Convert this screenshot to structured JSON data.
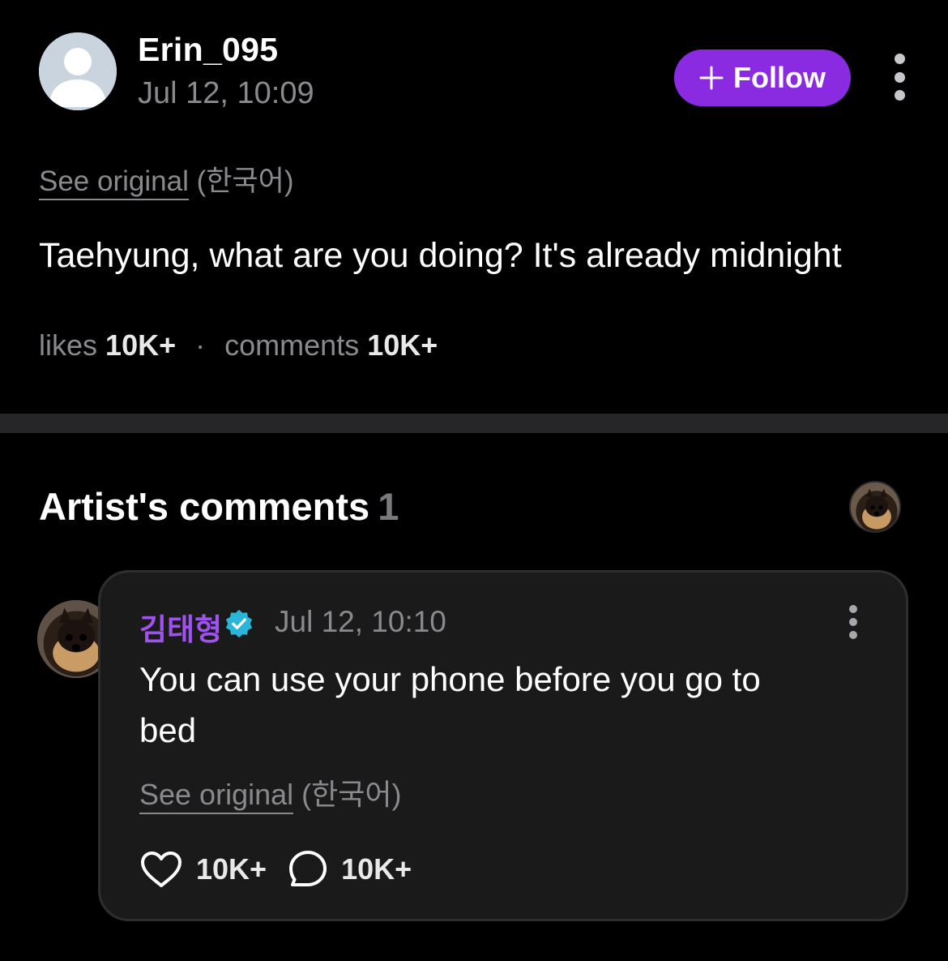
{
  "post": {
    "author_name": "Erin_095",
    "time": "Jul 12, 10:09",
    "follow_label": "Follow",
    "see_original_label": "See original",
    "language": "(한국어)",
    "body": "Taehyung, what are you doing? It's already midnight",
    "likes_label": "likes",
    "likes_count": "10K+",
    "separator": "·",
    "comments_label": "comments",
    "comments_count": "10K+"
  },
  "artist_comments": {
    "title": "Artist's comments",
    "count": "1",
    "comment": {
      "author_name": "김태형",
      "verified": true,
      "time": "Jul 12, 10:10",
      "body": "You can use your phone before you go to bed",
      "see_original_label": "See original",
      "language": "(한국어)",
      "likes_count": "10K+",
      "replies_count": "10K+"
    }
  },
  "colors": {
    "background": "#000000",
    "accent_purple": "#8a2be2",
    "artist_name": "#a052f0",
    "verified_badge": "#29b6d8",
    "muted_text": "#8a8a8e",
    "card_background": "#1a1a1b"
  },
  "icons": {
    "default_avatar": "person-silhouette-icon",
    "follow": "plus-icon",
    "more": "vertical-dots-icon",
    "verified": "verified-badge-icon",
    "like": "heart-outline-icon",
    "reply": "speech-bubble-icon"
  }
}
